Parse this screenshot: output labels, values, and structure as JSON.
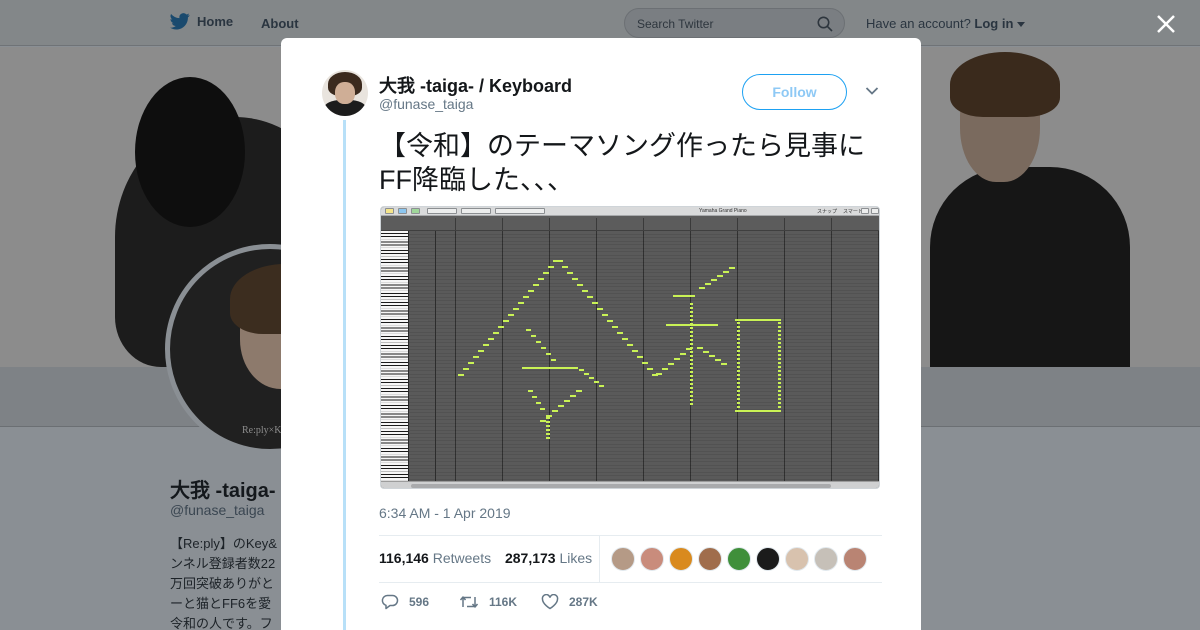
{
  "nav": {
    "home_label": "Home",
    "about_label": "About",
    "search_placeholder": "Search Twitter",
    "account_prompt": "Have an account?",
    "login_label": "Log in"
  },
  "background_profile": {
    "name": "大我 -taiga-",
    "handle": "@funase_taiga",
    "bio_lines": [
      "【Re:ply】のKey&",
      "ンネル登録者数22",
      "万回突破ありがと",
      "ーと猫とFF6を愛",
      "令和の人です。フ"
    ],
    "avatar_watermark": "Re:ply×K"
  },
  "tweet": {
    "author_name": "大我 -taiga- / Keyboard",
    "author_handle": "@funase_taiga",
    "follow_label": "Follow",
    "text_line_1": "【令和】のテーマソング作ったら見事に",
    "text_line_2": "FF降臨した、、、",
    "timestamp": "6:34 AM - 1 Apr 2019",
    "retweet_count": "116,146",
    "retweet_label": "Retweets",
    "like_count": "287,173",
    "like_label": "Likes",
    "actions": {
      "reply_count": "596",
      "retweet_count": "116K",
      "like_count": "287K"
    }
  },
  "media": {
    "toolbar_labels": [
      "Yamaha Grand Piano",
      "スナップ",
      "スマート"
    ],
    "note_color": "#c9f255"
  },
  "likers": [
    {
      "name": "liker-1",
      "color": "#b59a86"
    },
    {
      "name": "liker-2",
      "color": "#c98c7c"
    },
    {
      "name": "liker-3",
      "color": "#d98a1e"
    },
    {
      "name": "liker-4",
      "color": "#a06d4c"
    },
    {
      "name": "liker-5",
      "color": "#3f8f3a"
    },
    {
      "name": "liker-6",
      "color": "#1b1b1b"
    },
    {
      "name": "liker-7",
      "color": "#d8c2ae"
    },
    {
      "name": "liker-8",
      "color": "#c6c0b8"
    },
    {
      "name": "liker-9",
      "color": "#b98473"
    }
  ],
  "colors": {
    "accent": "#1da1f2",
    "thread_line": "#b8e0f8",
    "muted_text": "#657786"
  }
}
